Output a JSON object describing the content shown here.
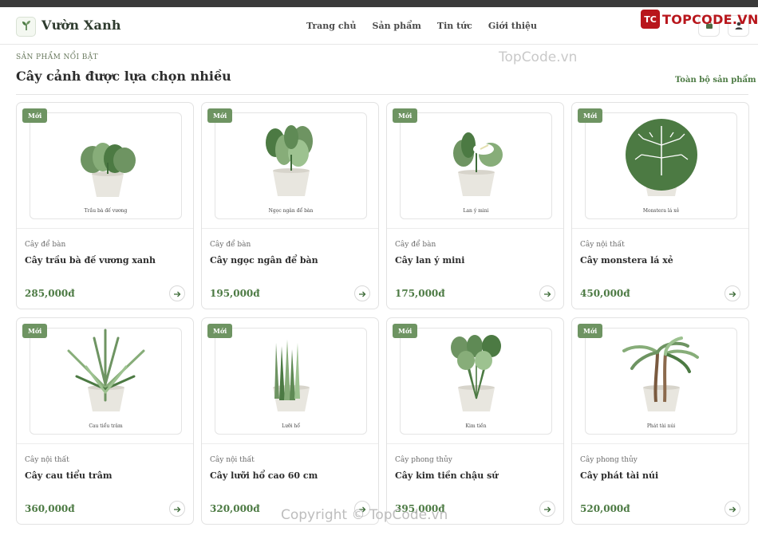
{
  "header": {
    "brand": "Vườn Xanh",
    "nav": [
      "Trang chủ",
      "Sản phẩm",
      "Tin tức",
      "Giới thiệu"
    ],
    "brand_color": "#4c7a43"
  },
  "topcode_badge": {
    "mark": "TC",
    "text": "TOPCODE.VN"
  },
  "watermarks": {
    "top": "TopCode.vn",
    "bottom": "Copyright © TopCode.vn"
  },
  "section": {
    "eyebrow": "SẢN PHẨM NỔI BẬT",
    "title": "Cây cảnh được lựa chọn nhiều",
    "all_link": "Toàn bộ sản phẩm →"
  },
  "products": [
    {
      "tag": "Mới",
      "caption": "Trầu bà đế vương",
      "category": "Cây để bàn",
      "name": "Cây trầu bà đế vương xanh",
      "price": "285,000đ"
    },
    {
      "tag": "Mới",
      "caption": "Ngọc ngân để bàn",
      "category": "Cây để bàn",
      "name": "Cây ngọc ngân để bàn",
      "price": "195,000đ"
    },
    {
      "tag": "Mới",
      "caption": "Lan ý mini",
      "category": "Cây để bàn",
      "name": "Cây lan ý mini",
      "price": "175,000đ"
    },
    {
      "tag": "Mới",
      "caption": "Monstera lá xẻ",
      "category": "Cây nội thất",
      "name": "Cây monstera lá xẻ",
      "price": "450,000đ"
    },
    {
      "tag": "Mới",
      "caption": "Cau tiểu trâm",
      "category": "Cây nội thất",
      "name": "Cây cau tiểu trâm",
      "price": "360,000đ"
    },
    {
      "tag": "Mới",
      "caption": "Lưỡi hổ",
      "category": "Cây nội thất",
      "name": "Cây lưỡi hổ cao 60 cm",
      "price": "320,000đ"
    },
    {
      "tag": "Mới",
      "caption": "Kim tiền",
      "category": "Cây phong thủy",
      "name": "Cây kim tiền chậu sứ",
      "price": "395,000đ"
    },
    {
      "tag": "Mới",
      "caption": "Phát tài núi",
      "category": "Cây phong thủy",
      "name": "Cây phát tài núi",
      "price": "520,000đ"
    }
  ]
}
